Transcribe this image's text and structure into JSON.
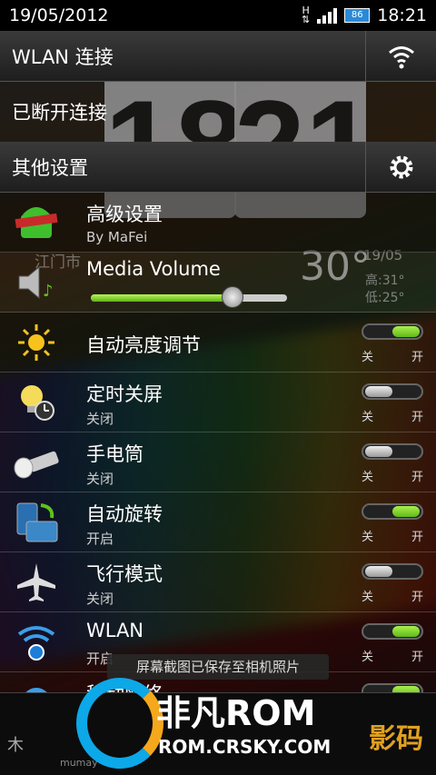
{
  "status_bar": {
    "date": "19/05/2012",
    "time": "18:21",
    "network": "H",
    "battery": "86"
  },
  "wlan_row": {
    "label": "WLAN 连接",
    "icon": "wifi-icon"
  },
  "wlan_status": {
    "label": "已断开连接"
  },
  "other_settings": {
    "label": "其他设置",
    "icon": "gear-icon"
  },
  "wallpaper": {
    "clock_hour": "18",
    "clock_min": "21",
    "city": "江门市",
    "temp": "30°",
    "date": "19/05",
    "high": "高:31°",
    "low": "低:25°"
  },
  "items": [
    {
      "title": "高级设置",
      "sub": "By MaFei",
      "icon": "android-icon"
    },
    {
      "title": "Media Volume",
      "icon": "speaker-icon",
      "volume": 0.72
    },
    {
      "title": "自动亮度调节",
      "icon": "sun-icon",
      "state": "on",
      "off_label": "关",
      "on_label": "开"
    },
    {
      "title": "定时关屏",
      "sub": "关闭",
      "icon": "bulb-clock-icon",
      "state": "off",
      "off_label": "关",
      "on_label": "开"
    },
    {
      "title": "手电筒",
      "sub": "关闭",
      "icon": "flashlight-icon",
      "state": "off",
      "off_label": "关",
      "on_label": "开"
    },
    {
      "title": "自动旋转",
      "sub": "开启",
      "icon": "rotate-icon",
      "state": "on",
      "off_label": "关",
      "on_label": "开"
    },
    {
      "title": "飞行模式",
      "sub": "关闭",
      "icon": "airplane-icon",
      "state": "off",
      "off_label": "关",
      "on_label": "开"
    },
    {
      "title": "WLAN",
      "sub": "开启",
      "icon": "wifi-icon",
      "state": "on",
      "off_label": "关",
      "on_label": "开"
    },
    {
      "title": "移动网络",
      "icon": "globe-icon",
      "state": "on"
    }
  ],
  "toast": "屏幕截图已保存至相机照片",
  "watermark": {
    "mumayi": "木",
    "mumayi_sub": "mumay",
    "brand_main": "非凡ROM",
    "brand_url": "ROM.CRSKY.COM",
    "brand_right": "影码"
  },
  "colors": {
    "switch_on": "#7ed321",
    "accent_blue": "#2a8ad8"
  }
}
